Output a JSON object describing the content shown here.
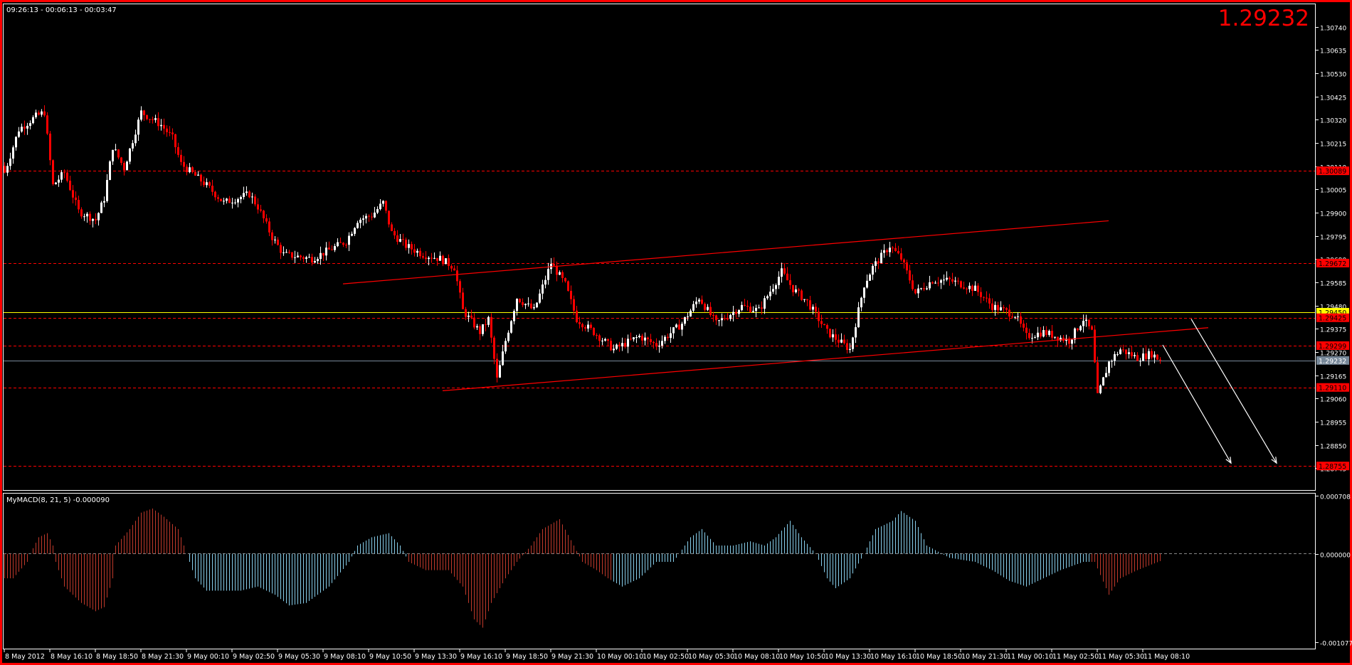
{
  "header": {
    "timer_text": "09:26:13 - 00:06:13 - 00:03:47",
    "current_price": "1.29232"
  },
  "colors": {
    "bull": "#ffffff",
    "bear": "#ff0000",
    "level": "#ff0000",
    "yellow": "#ffff00",
    "bid": "#778899",
    "macd_red": "#c0392b",
    "macd_blue": "#87ceeb"
  },
  "chart_data": [
    {
      "type": "candlestick",
      "title": "EURUSD M10",
      "ylim": [
        1.287,
        1.308
      ],
      "y_ticks": [
        "1.30740",
        "1.30635",
        "1.30530",
        "1.30425",
        "1.30320",
        "1.30215",
        "1.30110",
        "1.30005",
        "1.29900",
        "1.29795",
        "1.29690",
        "1.29585",
        "1.29480",
        "1.29375",
        "1.29270",
        "1.29165",
        "1.29060",
        "1.28955",
        "1.28850",
        "1.28745"
      ],
      "x_labels": [
        "8 May 2012",
        "8 May 16:10",
        "8 May 18:50",
        "8 May 21:30",
        "9 May 00:10",
        "9 May 02:50",
        "9 May 05:30",
        "9 May 08:10",
        "9 May 10:50",
        "9 May 13:30",
        "9 May 16:10",
        "9 May 18:50",
        "9 May 21:30",
        "10 May 00:10",
        "10 May 02:50",
        "10 May 05:30",
        "10 May 08:10",
        "10 May 10:50",
        "10 May 13:30",
        "10 May 16:10",
        "10 May 18:50",
        "10 May 21:30",
        "11 May 00:10",
        "11 May 02:50",
        "11 May 05:30",
        "11 May 08:10"
      ],
      "bars_per_label": 16,
      "close_path": [
        [
          0,
          1.30081
        ],
        [
          5,
          1.30276
        ],
        [
          11,
          1.30335
        ],
        [
          14,
          1.30354
        ],
        [
          17,
          1.30023
        ],
        [
          21,
          1.30081
        ],
        [
          26,
          1.29906
        ],
        [
          32,
          1.29867
        ],
        [
          35,
          1.29964
        ],
        [
          38,
          1.30198
        ],
        [
          42,
          1.30101
        ],
        [
          48,
          1.30354
        ],
        [
          55,
          1.30296
        ],
        [
          59,
          1.30237
        ],
        [
          62,
          1.3012
        ],
        [
          71,
          1.30023
        ],
        [
          77,
          1.29945
        ],
        [
          86,
          1.29984
        ],
        [
          89,
          1.29926
        ],
        [
          94,
          1.29789
        ],
        [
          98,
          1.29711
        ],
        [
          108,
          1.29692
        ],
        [
          114,
          1.29731
        ],
        [
          120,
          1.2977
        ],
        [
          124,
          1.29867
        ],
        [
          129,
          1.29887
        ],
        [
          133,
          1.29945
        ],
        [
          136,
          1.29809
        ],
        [
          141,
          1.2975
        ],
        [
          147,
          1.29711
        ],
        [
          153,
          1.29692
        ],
        [
          158,
          1.29653
        ],
        [
          161,
          1.29458
        ],
        [
          167,
          1.2936
        ],
        [
          170,
          1.29419
        ],
        [
          173,
          1.29146
        ],
        [
          176,
          1.29321
        ],
        [
          180,
          1.29516
        ],
        [
          186,
          1.29458
        ],
        [
          192,
          1.29672
        ],
        [
          197,
          1.29575
        ],
        [
          201,
          1.29419
        ],
        [
          207,
          1.2936
        ],
        [
          214,
          1.29282
        ],
        [
          223,
          1.29341
        ],
        [
          229,
          1.29302
        ],
        [
          238,
          1.29399
        ],
        [
          244,
          1.29516
        ],
        [
          250,
          1.29399
        ],
        [
          259,
          1.29477
        ],
        [
          265,
          1.29458
        ],
        [
          273,
          1.29633
        ],
        [
          277,
          1.29555
        ],
        [
          282,
          1.29497
        ],
        [
          289,
          1.2936
        ],
        [
          297,
          1.29282
        ],
        [
          302,
          1.29575
        ],
        [
          305,
          1.29653
        ],
        [
          311,
          1.2975
        ],
        [
          315,
          1.29692
        ],
        [
          320,
          1.29536
        ],
        [
          326,
          1.29594
        ],
        [
          332,
          1.29594
        ],
        [
          341,
          1.29555
        ],
        [
          347,
          1.29477
        ],
        [
          355,
          1.29438
        ],
        [
          359,
          1.29341
        ],
        [
          365,
          1.2936
        ],
        [
          374,
          1.29321
        ],
        [
          379,
          1.29419
        ],
        [
          382,
          1.2936
        ],
        [
          384,
          1.29068
        ],
        [
          388,
          1.29224
        ],
        [
          392,
          1.29282
        ],
        [
          398,
          1.29243
        ],
        [
          403,
          1.29263
        ],
        [
          406,
          1.29232
        ]
      ],
      "levels": [
        {
          "price": "1.30089",
          "style": "dashed",
          "color": "#ff0000"
        },
        {
          "price": "1.29672",
          "style": "dashed",
          "color": "#ff0000"
        },
        {
          "price": "1.29450",
          "style": "solid",
          "color": "#ffff00"
        },
        {
          "price": "1.29425",
          "style": "dashed",
          "color": "#ff0000"
        },
        {
          "price": "1.29299",
          "style": "dashed",
          "color": "#ff0000"
        },
        {
          "price": "1.29232",
          "style": "solid",
          "color": "#778899"
        },
        {
          "price": "1.29110",
          "style": "dashed",
          "color": "#ff0000"
        },
        {
          "price": "1.28755",
          "style": "dashed",
          "color": "#ff0000"
        }
      ],
      "trendlines": [
        {
          "from": [
            119,
            1.29578
          ],
          "to": [
            388,
            1.29863
          ],
          "color": "#ff0000"
        },
        {
          "from": [
            154,
            1.29095
          ],
          "to": [
            423,
            1.2938
          ],
          "color": "#ff0000"
        }
      ],
      "arrows": [
        {
          "from": [
            407,
            1.29302
          ],
          "to": [
            431,
            1.28768
          ],
          "color": "#ffffff"
        },
        {
          "from": [
            417,
            1.29419
          ],
          "to": [
            447,
            1.28768
          ],
          "color": "#ffffff"
        }
      ]
    },
    {
      "type": "bar",
      "title": "MyMACD(8, 21, 5) -0.000090",
      "ylim": [
        -0.001077,
        0.000708
      ],
      "y_ticks": [
        "0.000708",
        "0.000000",
        "-0.001077"
      ],
      "path": [
        [
          0,
          -0.0003
        ],
        [
          3,
          -0.0003
        ],
        [
          8,
          -0.0001
        ],
        [
          9,
          0.0
        ],
        [
          12,
          0.0002
        ],
        [
          15,
          0.00025
        ],
        [
          17,
          0.0001
        ],
        [
          18,
          -0.0001
        ],
        [
          21,
          -0.0004
        ],
        [
          27,
          -0.0006
        ],
        [
          32,
          -0.0007
        ],
        [
          35,
          -0.00065
        ],
        [
          38,
          -0.0003
        ],
        [
          39,
          0.0001
        ],
        [
          44,
          0.0003
        ],
        [
          48,
          0.0005
        ],
        [
          52,
          0.00055
        ],
        [
          56,
          0.00045
        ],
        [
          61,
          0.0003
        ],
        [
          64,
          0.0
        ],
        [
          67,
          -0.0003
        ],
        [
          71,
          -0.00045
        ],
        [
          77,
          -0.00045
        ],
        [
          83,
          -0.00045
        ],
        [
          89,
          -0.0004
        ],
        [
          95,
          -0.0005
        ],
        [
          100,
          -0.00063
        ],
        [
          106,
          -0.0006
        ],
        [
          114,
          -0.0004
        ],
        [
          121,
          -0.0001
        ],
        [
          124,
          0.0001
        ],
        [
          129,
          0.0002
        ],
        [
          135,
          0.00025
        ],
        [
          139,
          0.0001
        ],
        [
          142,
          -0.0001
        ],
        [
          148,
          -0.0002
        ],
        [
          156,
          -0.0002
        ],
        [
          161,
          -0.0004
        ],
        [
          165,
          -0.0008
        ],
        [
          168,
          -0.0009
        ],
        [
          171,
          -0.0006
        ],
        [
          176,
          -0.0003
        ],
        [
          180,
          -0.0001
        ],
        [
          185,
          0.0001
        ],
        [
          189,
          0.0003
        ],
        [
          195,
          0.00042
        ],
        [
          200,
          0.0001
        ],
        [
          203,
          -0.0001
        ],
        [
          208,
          -0.0002
        ],
        [
          212,
          -0.0003
        ],
        [
          217,
          -0.0004
        ],
        [
          223,
          -0.0003
        ],
        [
          229,
          -0.0001
        ],
        [
          235,
          -0.0001
        ],
        [
          241,
          0.0002
        ],
        [
          245,
          0.0003
        ],
        [
          250,
          0.0001
        ],
        [
          256,
          0.0001
        ],
        [
          262,
          0.00015
        ],
        [
          267,
          0.0001
        ],
        [
          271,
          0.0002
        ],
        [
          276,
          0.0004
        ],
        [
          280,
          0.0002
        ],
        [
          285,
          0.0
        ],
        [
          289,
          -0.0003
        ],
        [
          292,
          -0.00042
        ],
        [
          297,
          -0.0003
        ],
        [
          302,
          0.0
        ],
        [
          306,
          0.0003
        ],
        [
          312,
          0.0004
        ],
        [
          315,
          0.00052
        ],
        [
          320,
          0.0004
        ],
        [
          324,
          0.0001
        ],
        [
          332,
          -5e-05
        ],
        [
          341,
          -0.0001
        ],
        [
          347,
          -0.0002
        ],
        [
          353,
          -0.00033
        ],
        [
          359,
          -0.0004
        ],
        [
          365,
          -0.0003
        ],
        [
          371,
          -0.0002
        ],
        [
          379,
          -0.0001
        ],
        [
          383,
          -0.0001
        ],
        [
          388,
          -0.0005
        ],
        [
          392,
          -0.0003
        ],
        [
          398,
          -0.0002
        ],
        [
          406,
          -9e-05
        ]
      ],
      "blue_ranges": [
        [
          65,
          141
        ],
        [
          214,
          381
        ]
      ]
    }
  ]
}
